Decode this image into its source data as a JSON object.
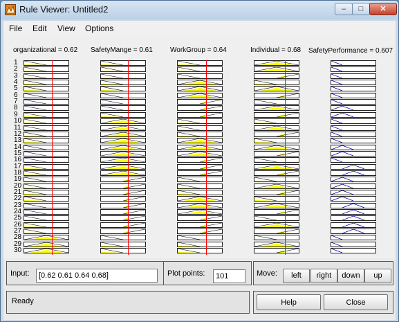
{
  "window": {
    "title": "Rule Viewer: Untitled2",
    "controls": {
      "minimize": "–",
      "maximize": "□",
      "close": "✕"
    }
  },
  "menu": [
    "File",
    "Edit",
    "View",
    "Options"
  ],
  "variables": [
    {
      "label": "organizational = 0.62",
      "value": 0.62,
      "kind": "input"
    },
    {
      "label": "SafetyMange = 0.61",
      "value": 0.61,
      "kind": "input"
    },
    {
      "label": "WorkGroup = 0.64",
      "value": 0.64,
      "kind": "input"
    },
    {
      "label": "Individual = 0.68",
      "value": 0.68,
      "kind": "input"
    },
    {
      "label": "SafetyPerformance = 0.607",
      "value": 0.607,
      "kind": "output"
    }
  ],
  "rule_numbers": [
    "1",
    "2",
    "3",
    "4",
    "5",
    "6",
    "7",
    "8",
    "9",
    "10",
    "11",
    "12",
    "13",
    "14",
    "15",
    "16",
    "17",
    "18",
    "19",
    "20",
    "21",
    "22",
    "23",
    "24",
    "25",
    "26",
    "27",
    "28",
    "29",
    "30"
  ],
  "rules": [
    [
      "L",
      "L",
      "L",
      "M",
      "A"
    ],
    [
      "L",
      "L",
      "L",
      "M",
      "A"
    ],
    [
      "L",
      "L",
      "L",
      "H",
      "A"
    ],
    [
      "L",
      "L",
      "M",
      "L",
      "A"
    ],
    [
      "L",
      "L",
      "M",
      "M",
      "A"
    ],
    [
      "L",
      "L",
      "M",
      "H",
      "A"
    ],
    [
      "L",
      "L",
      "H",
      "L",
      "A"
    ],
    [
      "L",
      "L",
      "H",
      "M",
      "B"
    ],
    [
      "L",
      "L",
      "H",
      "H",
      "B"
    ],
    [
      "L",
      "M",
      "L",
      "L",
      "A"
    ],
    [
      "L",
      "M",
      "L",
      "M",
      "A"
    ],
    [
      "L",
      "M",
      "L",
      "H",
      "A"
    ],
    [
      "L",
      "M",
      "M",
      "L",
      "A"
    ],
    [
      "L",
      "M",
      "M",
      "M",
      "B"
    ],
    [
      "L",
      "M",
      "M",
      "H",
      "B"
    ],
    [
      "L",
      "M",
      "H",
      "L",
      "A"
    ],
    [
      "L",
      "M",
      "H",
      "M",
      "C"
    ],
    [
      "L",
      "M",
      "H",
      "H",
      "C"
    ],
    [
      "L",
      "H",
      "L",
      "L",
      "B"
    ],
    [
      "L",
      "H",
      "L",
      "M",
      "B"
    ],
    [
      "L",
      "H",
      "L",
      "H",
      "B"
    ],
    [
      "L",
      "H",
      "M",
      "L",
      "B"
    ],
    [
      "L",
      "H",
      "M",
      "M",
      "C"
    ],
    [
      "L",
      "H",
      "M",
      "H",
      "C"
    ],
    [
      "L",
      "H",
      "H",
      "L",
      "C"
    ],
    [
      "L",
      "H",
      "H",
      "M",
      "C"
    ],
    [
      "L",
      "H",
      "H",
      "H",
      "C"
    ],
    [
      "M",
      "L",
      "L",
      "L",
      "A"
    ],
    [
      "M",
      "L",
      "L",
      "M",
      "A"
    ],
    [
      "M",
      "L",
      "L",
      "H",
      "A"
    ]
  ],
  "panel": {
    "input_label": "Input:",
    "input_value": "[0.62 0.61 0.64 0.68]",
    "plot_points_label": "Plot points:",
    "plot_points_value": "101",
    "move_label": "Move:",
    "move_buttons": [
      "left",
      "right",
      "down",
      "up"
    ],
    "status": "Ready",
    "help_label": "Help",
    "close_label": "Close"
  },
  "colors": {
    "fill": "#ffff00",
    "red_line": "#ff0000",
    "output_line": "#0000a0"
  }
}
